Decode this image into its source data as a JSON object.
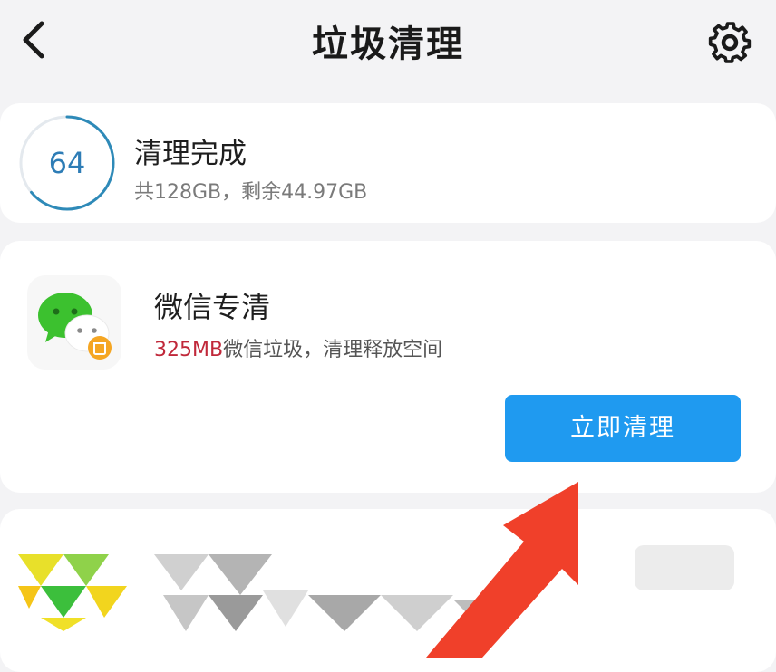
{
  "header": {
    "title": "垃圾清理",
    "back_icon": "back-arrow-icon",
    "settings_icon": "gear-icon"
  },
  "storage": {
    "score": "64",
    "title": "清理完成",
    "subtitle": "共128GB，剩余44.97GB",
    "ring_color": "#2e8ab8"
  },
  "wechat": {
    "title": "微信专清",
    "junk_amount": "325MB",
    "junk_text": "微信垃圾，清理释放空间",
    "button_label": "立即清理",
    "icon": "wechat-icon",
    "button_color": "#1f9af0",
    "amount_color": "#c0283a"
  },
  "annotation": {
    "arrow_color": "#f0402a"
  }
}
